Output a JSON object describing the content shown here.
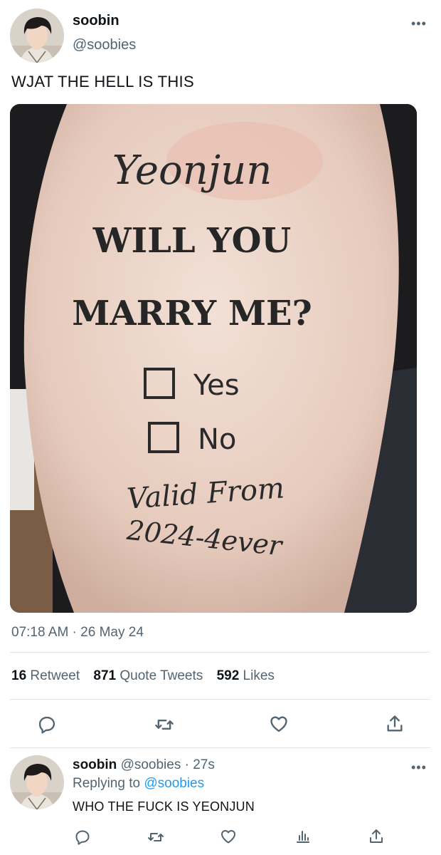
{
  "tweet": {
    "author_name": "soobin",
    "author_handle": "@soobies",
    "text": "WJAT THE HELL IS THIS",
    "timestamp": "07:18 AM · 26 May 24",
    "more_icon": "more-horizontal-icon",
    "image": {
      "lines": [
        "Yeonjun",
        "WILL YOU",
        "MARRY ME?",
        "Yes",
        "No",
        "Valid From",
        "2024-4ever"
      ]
    },
    "stats": {
      "retweets_count": "16",
      "retweets_label": "Retweet",
      "quotes_count": "871",
      "quotes_label": "Quote Tweets",
      "likes_count": "592",
      "likes_label": "Likes"
    },
    "actions": [
      "reply-icon",
      "retweet-icon",
      "like-icon",
      "share-icon"
    ]
  },
  "reply": {
    "author_name": "soobin",
    "author_handle": "@soobies",
    "time": "· 27s",
    "replying_prefix": "Replying to",
    "replying_to": "@soobies",
    "text": "WHO THE FUCK IS YEONJUN",
    "actions": [
      "reply-icon",
      "retweet-icon",
      "like-icon",
      "analytics-icon",
      "share-icon"
    ]
  },
  "colors": {
    "link": "#1d9bf0",
    "secondary_text": "#536471",
    "primary_text": "#0f1419",
    "divider": "#e1e4e8"
  }
}
